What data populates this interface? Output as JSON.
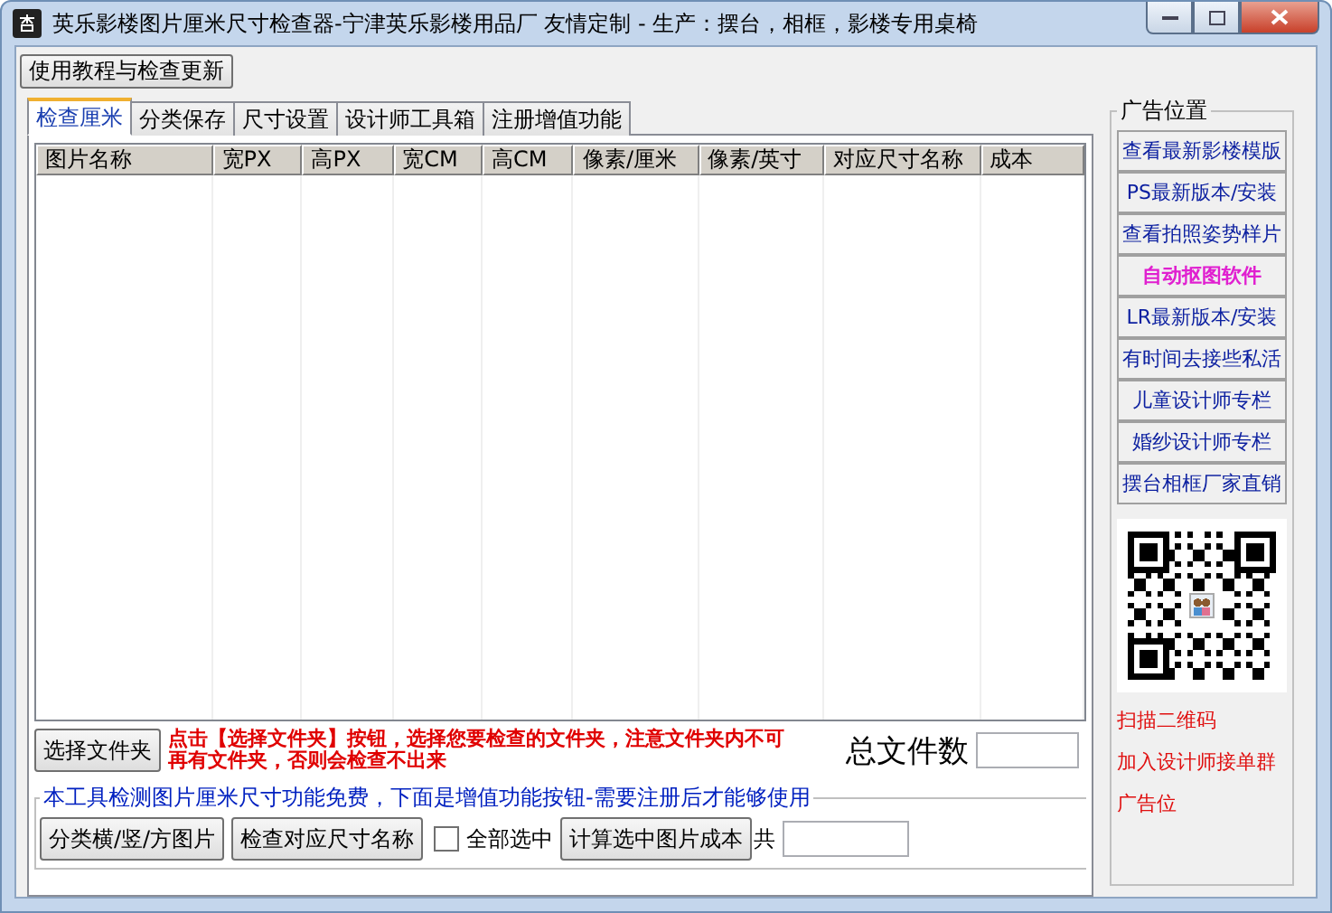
{
  "window": {
    "title": "英乐影楼图片厘米尺寸检查器-宁津英乐影楼用品厂 友情定制 - 生产：摆台，相框，影楼专用桌椅"
  },
  "menu_button": "使用教程与检查更新",
  "tabs": [
    {
      "label": "检查厘米",
      "selected": true
    },
    {
      "label": "分类保存",
      "selected": false
    },
    {
      "label": "尺寸设置",
      "selected": false
    },
    {
      "label": "设计师工具箱",
      "selected": false
    },
    {
      "label": "注册增值功能",
      "selected": false
    }
  ],
  "table": {
    "columns": [
      "图片名称",
      "宽PX",
      "高PX",
      "宽CM",
      "高CM",
      "像素/厘米",
      "像素/英寸",
      "对应尺寸名称",
      "成本"
    ]
  },
  "select_folder_button": "选择文件夹",
  "hint": "点击【选择文件夹】按钮，选择您要检查的文件夹，注意文件夹内不可再有文件夹，否则会检查不出来",
  "total_label": "总文件数",
  "value_added": {
    "title": "本工具检测图片厘米尺寸功能免费，下面是增值功能按钮-需要注册后才能够使用",
    "buttons": [
      "分类横/竖/方图片",
      "检查对应尺寸名称"
    ],
    "select_all": {
      "label": "全部选中",
      "checked": false
    },
    "cost_button": "计算选中图片成本",
    "total_prefix": "共"
  },
  "ad_panel": {
    "title": "广告位置",
    "links": [
      {
        "label": "查看最新影楼模版",
        "highlighted": false
      },
      {
        "label": "PS最新版本/安装",
        "highlighted": false
      },
      {
        "label": "查看拍照姿势样片",
        "highlighted": false
      },
      {
        "label": "自动抠图软件",
        "highlighted": true
      },
      {
        "label": "LR最新版本/安装",
        "highlighted": false
      },
      {
        "label": "有时间去接些私活",
        "highlighted": false
      },
      {
        "label": "儿童设计师专栏",
        "highlighted": false
      },
      {
        "label": "婚纱设计师专栏",
        "highlighted": false
      },
      {
        "label": "摆台相框厂家直销",
        "highlighted": false
      }
    ],
    "notes": [
      "扫描二维码",
      "加入设计师接单群",
      "广告位"
    ]
  }
}
